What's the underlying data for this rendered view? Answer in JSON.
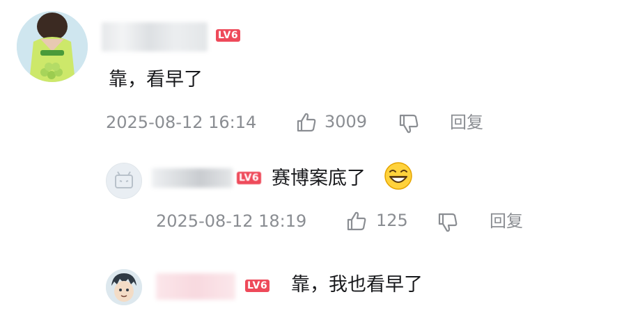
{
  "comment": {
    "level_badge": "LV6",
    "content": "靠，看早了",
    "time": "2025-08-12 16:14",
    "like_count": "3009",
    "reply_label": "回复"
  },
  "replies": [
    {
      "level_badge": "LV6",
      "content": "赛博案底了",
      "emoji": "grinning-face-emoji",
      "time": "2025-08-12 18:19",
      "like_count": "125",
      "reply_label": "回复"
    },
    {
      "level_badge": "LV6",
      "content": "靠，我也看早了"
    }
  ],
  "icons": {
    "like": "thumbs-up-icon",
    "dislike": "thumbs-down-icon"
  },
  "colors": {
    "badge": "#ee4a5a",
    "meta_text": "#8a8d92",
    "body_text": "#18191c"
  }
}
